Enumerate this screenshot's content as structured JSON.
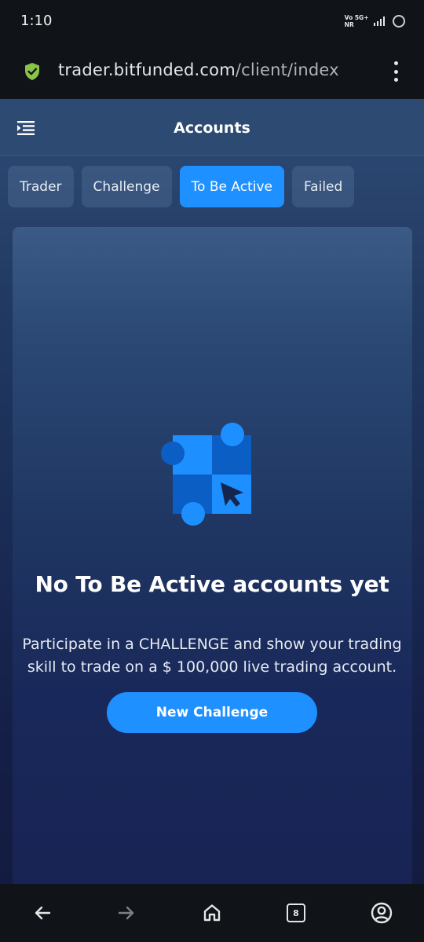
{
  "status_bar": {
    "time": "1:10",
    "network_top": "Vo 5G+",
    "network_bottom": "NR"
  },
  "browser": {
    "url_host": "trader.bitfunded.com",
    "url_path": "/client/index",
    "tab_count": "8"
  },
  "header": {
    "title": "Accounts"
  },
  "tabs": [
    {
      "label": "Trader",
      "active": false
    },
    {
      "label": "Challenge",
      "active": false
    },
    {
      "label": "To Be Active",
      "active": true
    },
    {
      "label": "Failed",
      "active": false
    }
  ],
  "empty_state": {
    "title": "No To Be Active accounts yet",
    "description": "Participate in a CHALLENGE and show your trading skill to trade on a $ 100,000 live trading account.",
    "button_label": "New Challenge"
  },
  "colors": {
    "accent": "#1e90ff",
    "header_bg": "#2d4a72",
    "browser_bg": "#101418",
    "shield_green": "#8bc34a"
  }
}
